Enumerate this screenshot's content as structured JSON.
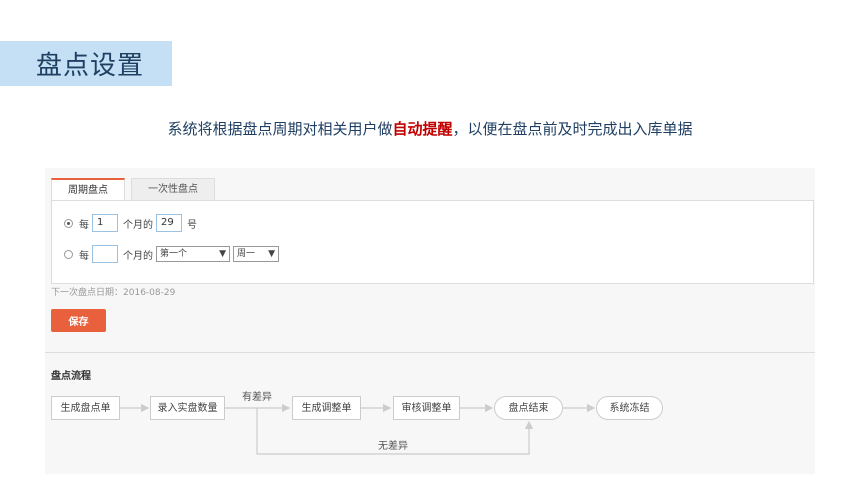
{
  "page": {
    "title": "盘点设置",
    "subtitle_pre": "系统将根据盘点周期对相关用户做",
    "subtitle_highlight": "自动提醒",
    "subtitle_post": "，以便在盘点前及时完成出入库单据"
  },
  "tabs": [
    {
      "label": "周期盘点",
      "active": true
    },
    {
      "label": "一次性盘点",
      "active": false
    }
  ],
  "form": {
    "row1": {
      "prefix": "每",
      "value": "1",
      "mid": "个月的",
      "day": "29",
      "suffix": "号",
      "selected": true
    },
    "row2": {
      "prefix": "每",
      "value": "",
      "mid": "个月的",
      "week_option": "第一个",
      "weekday_option": "周一",
      "selected": false
    },
    "next_date_label": "下一次盘点日期：",
    "next_date_value": "2016-08-29",
    "save_label": "保存"
  },
  "flow": {
    "title": "盘点流程",
    "nodes": [
      "生成盘点单",
      "录入实盘数量",
      "生成调整单",
      "审核调整单",
      "盘点结束",
      "系统冻结"
    ],
    "label_diff": "有差异",
    "label_nodiff": "无差异"
  },
  "colors": {
    "accent": "#e8603c",
    "highlight": "#c00000",
    "banner": "#c5e0f4",
    "title_text": "#1f3f63"
  }
}
